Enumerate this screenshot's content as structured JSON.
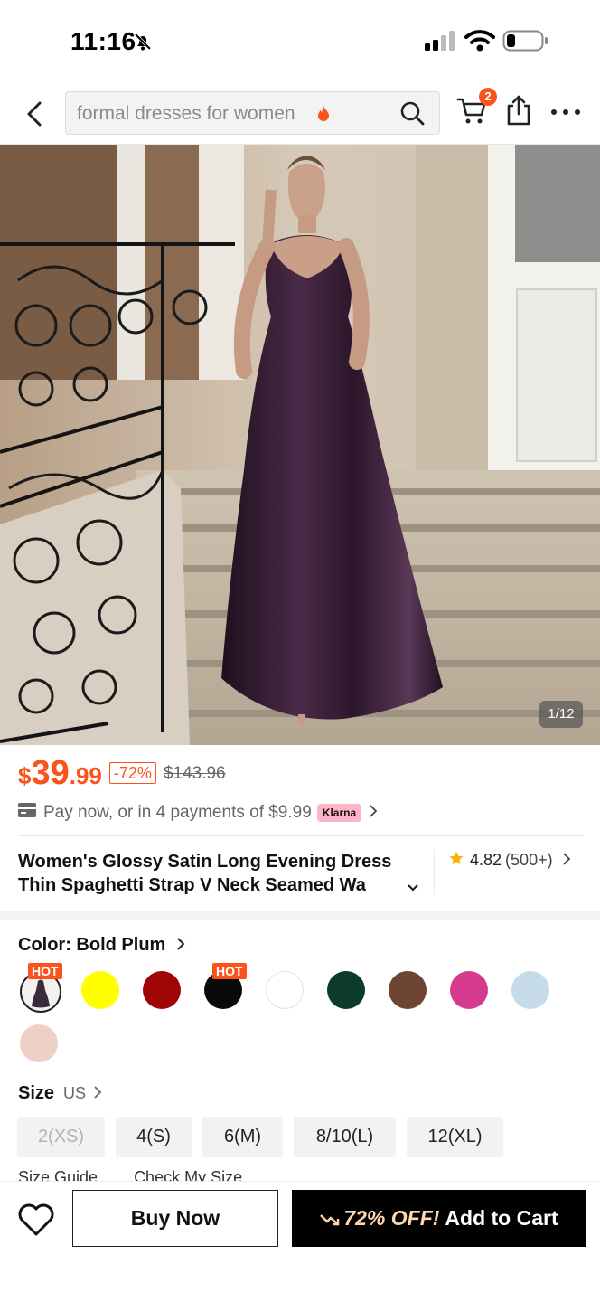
{
  "status_bar": {
    "time": "11:16"
  },
  "header": {
    "search_placeholder": "formal dresses for women",
    "cart_count": "2",
    "icons": {
      "back": "chevron-left-icon",
      "search": "search-icon",
      "cart": "cart-icon",
      "share": "share-icon",
      "more": "more-icon"
    }
  },
  "gallery": {
    "counter": "1/12"
  },
  "price": {
    "currency": "$",
    "main": "39",
    "cents": ".99",
    "discount": "-72%",
    "original": "$143.96"
  },
  "payment": {
    "text": "Pay now, or in 4 payments of $9.99",
    "provider": "Klarna"
  },
  "product": {
    "title_line1": "Women's Glossy Satin Long Evening Dress",
    "title_line2": "Thin Spaghetti Strap V Neck Seamed Wa",
    "rating": "4.82",
    "review_count": "(500+)"
  },
  "color": {
    "label": "Color: Bold Plum",
    "hot_label": "HOT",
    "swatches": [
      {
        "name": "Bold Plum",
        "hex": "#3b2a3c",
        "hot": true,
        "selected": true
      },
      {
        "name": "Yellow",
        "hex": "#ffff00"
      },
      {
        "name": "Red",
        "hex": "#a00505"
      },
      {
        "name": "Black",
        "hex": "#0a0a0a",
        "hot": true
      },
      {
        "name": "White",
        "hex": "#ffffff"
      },
      {
        "name": "Dark Green",
        "hex": "#0d3b2a"
      },
      {
        "name": "Brown",
        "hex": "#6e4532"
      },
      {
        "name": "Pink",
        "hex": "#d63a8c"
      },
      {
        "name": "Light Blue",
        "hex": "#c6dbe8"
      },
      {
        "name": "Champagne",
        "hex": "#efd0c6"
      }
    ]
  },
  "size": {
    "label": "Size",
    "unit": "US",
    "options": [
      "2(XS)",
      "4(S)",
      "6(M)",
      "8/10(L)",
      "12(XL)"
    ],
    "guide": "Size Guide",
    "check": "Check My Size"
  },
  "bottom_bar": {
    "buy_now": "Buy Now",
    "promo": "72% OFF!",
    "add_to_cart": "Add to Cart"
  },
  "colors": {
    "accent": "#fa541c",
    "klarna": "#ffb3c7"
  }
}
